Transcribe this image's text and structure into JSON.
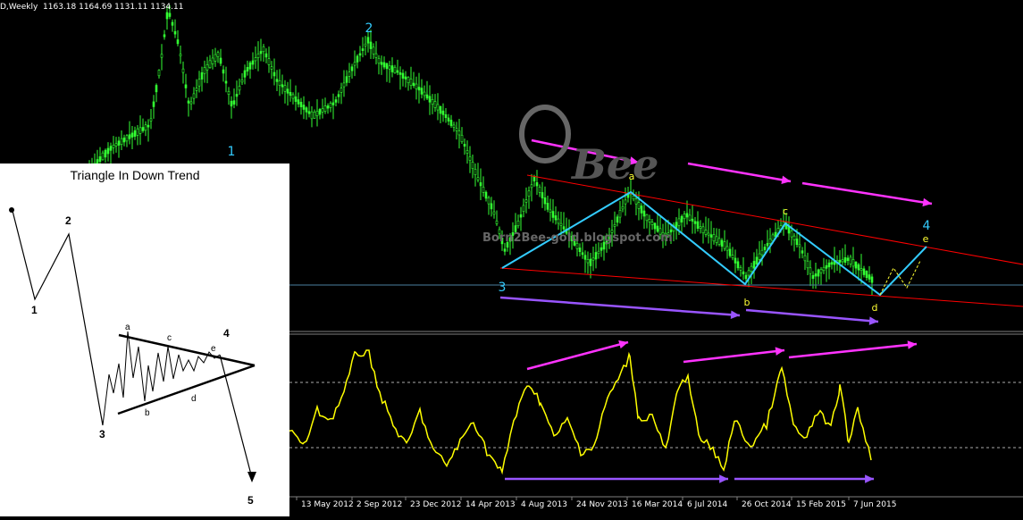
{
  "header": {
    "symbol": "D,Weekly",
    "ohlc": "1163.18 1164.69 1131.11 1134.11"
  },
  "chart_data": [
    {
      "type": "line",
      "name": "price",
      "x_dates": [
        "13 May 2012",
        "2 Sep 2012",
        "23 Dec 2012",
        "14 Apr 2013",
        "4 Aug 2013",
        "24 Nov 2013",
        "16 Mar 2014",
        "6 Jul 2014",
        "26 Oct 2014",
        "15 Feb 2015",
        "7 Jun 2015"
      ],
      "wave_labels": [
        {
          "label": "1",
          "color": "#33ccff"
        },
        {
          "label": "2",
          "color": "#33ccff"
        },
        {
          "label": "3",
          "color": "#33ccff"
        },
        {
          "label": "4",
          "color": "#33ccff"
        },
        {
          "label": "a",
          "color": "#ffff33"
        },
        {
          "label": "b",
          "color": "#ffff33"
        },
        {
          "label": "c",
          "color": "#ffff33"
        },
        {
          "label": "d",
          "color": "#ffff33"
        },
        {
          "label": "e",
          "color": "#ffff33"
        }
      ],
      "price_color": "#33ff33",
      "triangle_color": "#33ccff",
      "trendline_color": "#ff0000",
      "arrow_colors": {
        "top": "#ff33ff",
        "bottom": "#9955ff"
      },
      "watermark": "Bee",
      "watermark_url": "Born2Bee-gold.blogspot.com"
    },
    {
      "type": "line",
      "name": "oscillator",
      "color": "#ffff00",
      "levels": [
        "upper dashed",
        "lower dashed"
      ]
    }
  ],
  "inset": {
    "title": "Triangle In Down Trend",
    "labels": [
      "1",
      "2",
      "3",
      "4",
      "5",
      "a",
      "b",
      "c",
      "d",
      "e"
    ]
  },
  "colors": {
    "background": "#000000",
    "grid": "#808080"
  }
}
